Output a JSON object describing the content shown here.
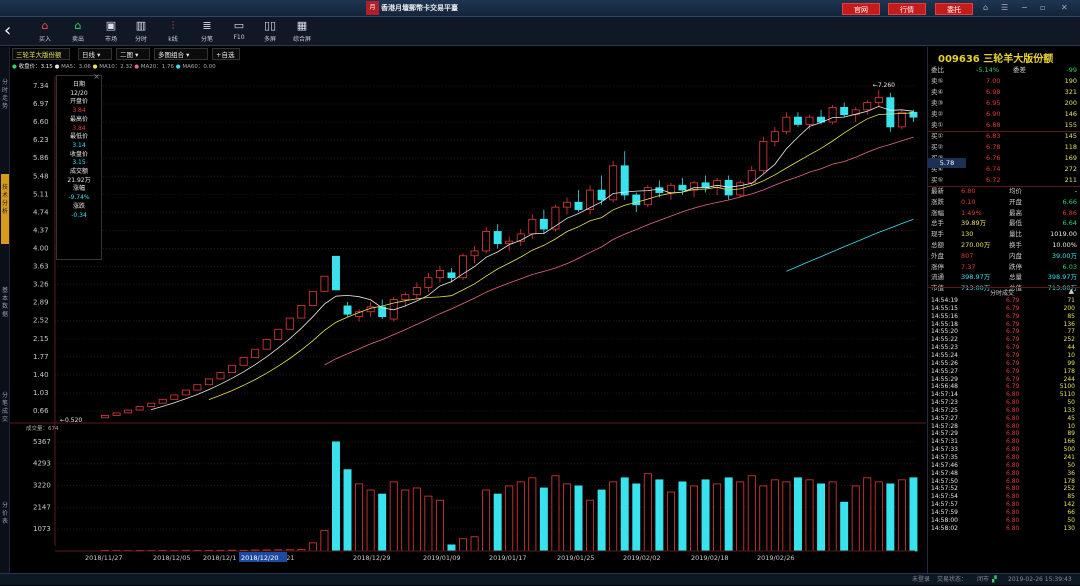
{
  "window": {
    "title": "香港月壇郵幣卡交易平臺",
    "logo": "月",
    "buttons": [
      "官网",
      "行情",
      "委托"
    ],
    "controls": [
      "⌂",
      "☰",
      "−",
      "▫",
      "✕"
    ]
  },
  "toolbar": [
    {
      "label": "买入",
      "icon": "buy-icon",
      "glyph": "⌂",
      "color": "#e84a4a"
    },
    {
      "label": "卖出",
      "icon": "sell-icon",
      "glyph": "⌂",
      "color": "#39d36b"
    },
    {
      "label": "市场",
      "icon": "market-icon",
      "glyph": "▣",
      "color": "#dde"
    },
    {
      "label": "分时",
      "icon": "timeshare-icon",
      "glyph": "▥",
      "color": "#dde"
    },
    {
      "label": "k线",
      "icon": "kline-icon",
      "glyph": "⫶",
      "color": "#e84a4a"
    },
    {
      "label": "分笔",
      "icon": "ticks-icon",
      "glyph": "≣",
      "color": "#dde"
    },
    {
      "label": "F10",
      "icon": "f10-icon",
      "glyph": "▭",
      "color": "#dde"
    },
    {
      "label": "多屏",
      "icon": "multiscreen-icon",
      "glyph": "▯▯",
      "color": "#dde"
    },
    {
      "label": "综合屏",
      "icon": "composite-icon",
      "glyph": "▦",
      "color": "#dde"
    }
  ],
  "sidebar": [
    {
      "label": "分时走势",
      "active": false
    },
    {
      "label": "技术分析",
      "active": true
    },
    {
      "label": "基本数据",
      "active": false
    },
    {
      "label": "分笔成交",
      "active": false
    },
    {
      "label": "分价表",
      "active": false
    }
  ],
  "tabs": {
    "name": "三轮羊大版份额",
    "period": "日线",
    "layout": "二图",
    "combo": "多图组合",
    "watch": "+自选"
  },
  "legend": {
    "close": "收盘价：3.15",
    "ma5": "MA5：3.06",
    "ma10": "MA10：2.32",
    "ma20": "MA20：1.76",
    "ma60": "MA60：0.00",
    "volume": "成交量：674"
  },
  "tooltip": {
    "date_label": "日期",
    "date": "12/20",
    "open_label": "开盘价",
    "open": "3.84",
    "high_label": "最高价",
    "high": "3.84",
    "low_label": "最低价",
    "low": "3.14",
    "close_label": "收盘价",
    "close": "3.15",
    "amount_label": "成交额",
    "amount": "21.92万",
    "change_pct_label": "涨幅",
    "change_pct": "-9.74%",
    "change_label": "涨跌",
    "change": "-0.34"
  },
  "chart_data": {
    "type": "candlestick",
    "y_ticks": [
      "7.34",
      "6.97",
      "6.60",
      "6.23",
      "5.86",
      "5.48",
      "5.11",
      "4.74",
      "4.37",
      "4.00",
      "3.63",
      "3.26",
      "2.89",
      "2.52",
      "2.15",
      "1.77",
      "1.40",
      "1.03",
      "0.66"
    ],
    "vol_ticks": [
      "5367",
      "4293",
      "3220",
      "2147",
      "1073"
    ],
    "x_ticks": [
      "2018/11/27",
      "2018/12/05",
      "2018/12/1",
      "2018/12/21",
      "2018/12/29",
      "2019/01/09",
      "2019/01/17",
      "2019/01/25",
      "2019/02/02",
      "2019/02/18",
      "2019/02/26"
    ],
    "cursor_date": "2018/12/20",
    "cursor_price": "5.78",
    "max_label": "←7.260",
    "min_label": "←0.520",
    "candles": [
      [
        0.52,
        0.57,
        0.52,
        0.57
      ],
      [
        0.57,
        0.62,
        0.57,
        0.62
      ],
      [
        0.62,
        0.68,
        0.62,
        0.68
      ],
      [
        0.68,
        0.75,
        0.68,
        0.75
      ],
      [
        0.75,
        0.82,
        0.75,
        0.82
      ],
      [
        0.82,
        0.9,
        0.82,
        0.9
      ],
      [
        0.9,
        0.99,
        0.9,
        0.99
      ],
      [
        0.99,
        1.09,
        0.99,
        1.09
      ],
      [
        1.09,
        1.2,
        1.09,
        1.2
      ],
      [
        1.2,
        1.32,
        1.2,
        1.32
      ],
      [
        1.32,
        1.45,
        1.32,
        1.45
      ],
      [
        1.45,
        1.6,
        1.45,
        1.6
      ],
      [
        1.6,
        1.76,
        1.6,
        1.76
      ],
      [
        1.76,
        1.93,
        1.76,
        1.93
      ],
      [
        1.93,
        2.13,
        1.93,
        2.13
      ],
      [
        2.13,
        2.34,
        2.13,
        2.34
      ],
      [
        2.34,
        2.57,
        2.34,
        2.57
      ],
      [
        2.57,
        2.83,
        2.57,
        2.83
      ],
      [
        2.83,
        3.12,
        2.83,
        3.12
      ],
      [
        3.12,
        3.43,
        3.12,
        3.43
      ],
      [
        3.84,
        3.84,
        3.14,
        3.15
      ],
      [
        2.82,
        2.9,
        2.6,
        2.65
      ],
      [
        2.6,
        2.75,
        2.5,
        2.7
      ],
      [
        2.7,
        2.9,
        2.6,
        2.8
      ],
      [
        2.8,
        2.95,
        2.55,
        2.6
      ],
      [
        2.55,
        3.0,
        2.5,
        2.95
      ],
      [
        2.95,
        3.1,
        2.8,
        3.05
      ],
      [
        3.05,
        3.3,
        2.95,
        3.2
      ],
      [
        3.2,
        3.5,
        3.1,
        3.4
      ],
      [
        3.4,
        3.65,
        3.3,
        3.55
      ],
      [
        3.5,
        3.6,
        3.3,
        3.4
      ],
      [
        3.4,
        3.9,
        3.35,
        3.85
      ],
      [
        3.85,
        4.05,
        3.7,
        3.95
      ],
      [
        3.95,
        4.45,
        3.9,
        4.35
      ],
      [
        4.35,
        4.5,
        4.0,
        4.1
      ],
      [
        4.1,
        4.25,
        3.95,
        4.15
      ],
      [
        4.15,
        4.4,
        4.05,
        4.3
      ],
      [
        4.3,
        4.7,
        4.2,
        4.6
      ],
      [
        4.6,
        4.8,
        4.3,
        4.4
      ],
      [
        4.4,
        4.9,
        4.35,
        4.85
      ],
      [
        4.85,
        5.05,
        4.7,
        4.95
      ],
      [
        4.95,
        5.2,
        4.75,
        4.8
      ],
      [
        4.8,
        5.3,
        4.7,
        5.2
      ],
      [
        5.2,
        5.5,
        4.9,
        5.0
      ],
      [
        5.0,
        5.8,
        4.95,
        5.7
      ],
      [
        5.7,
        6.0,
        5.0,
        5.1
      ],
      [
        5.1,
        5.15,
        4.75,
        4.9
      ],
      [
        4.9,
        5.3,
        4.85,
        5.25
      ],
      [
        5.25,
        5.4,
        5.05,
        5.15
      ],
      [
        5.15,
        5.35,
        5.0,
        5.3
      ],
      [
        5.3,
        5.45,
        5.1,
        5.2
      ],
      [
        5.2,
        5.4,
        5.05,
        5.35
      ],
      [
        5.35,
        5.5,
        5.15,
        5.25
      ],
      [
        5.25,
        5.45,
        5.1,
        5.4
      ],
      [
        5.4,
        5.5,
        5.0,
        5.1
      ],
      [
        5.1,
        5.4,
        5.05,
        5.35
      ],
      [
        5.35,
        5.7,
        5.3,
        5.6
      ],
      [
        5.6,
        6.3,
        5.55,
        6.2
      ],
      [
        6.2,
        6.5,
        6.1,
        6.4
      ],
      [
        6.4,
        6.8,
        6.35,
        6.7
      ],
      [
        6.7,
        6.8,
        6.5,
        6.55
      ],
      [
        6.55,
        6.75,
        6.45,
        6.7
      ],
      [
        6.7,
        6.85,
        6.55,
        6.6
      ],
      [
        6.6,
        6.95,
        6.55,
        6.9
      ],
      [
        6.9,
        7.0,
        6.7,
        6.75
      ],
      [
        6.75,
        6.9,
        6.6,
        6.85
      ],
      [
        6.85,
        7.05,
        6.75,
        7.0
      ],
      [
        7.0,
        7.26,
        6.9,
        7.1
      ],
      [
        7.1,
        7.2,
        6.4,
        6.5
      ],
      [
        6.5,
        6.85,
        6.45,
        6.8
      ],
      [
        6.8,
        6.85,
        6.6,
        6.7
      ]
    ],
    "volumes": [
      30,
      25,
      20,
      28,
      22,
      30,
      25,
      35,
      30,
      28,
      32,
      40,
      35,
      45,
      50,
      55,
      60,
      70,
      400,
      1000,
      5367,
      4000,
      3300,
      3000,
      2800,
      3400,
      3000,
      3100,
      2700,
      2500,
      300,
      600,
      700,
      3000,
      2800,
      3200,
      3400,
      3600,
      3100,
      3700,
      3300,
      3200,
      2500,
      3000,
      3400,
      3600,
      3300,
      3800,
      3500,
      2900,
      3400,
      3200,
      3500,
      3300,
      3600,
      3400,
      3700,
      3200,
      3500,
      3400,
      3600,
      3500,
      3300,
      3400,
      2400,
      3200,
      3600,
      3400,
      3300,
      3500,
      3600
    ]
  },
  "quote": {
    "code": "009636",
    "name": "三轮羊大版份额",
    "ratio": {
      "label": "委比",
      "value": "-5.14%",
      "diff_label": "委差",
      "diff": "-99"
    },
    "asks": [
      {
        "label": "卖⑤",
        "price": "7.00",
        "vol": "190"
      },
      {
        "label": "卖④",
        "price": "6.98",
        "vol": "321"
      },
      {
        "label": "卖③",
        "price": "6.95",
        "vol": "200"
      },
      {
        "label": "卖②",
        "price": "6.90",
        "vol": "146"
      },
      {
        "label": "卖①",
        "price": "6.88",
        "vol": "155"
      }
    ],
    "bids": [
      {
        "label": "买①",
        "price": "6.83",
        "vol": "145"
      },
      {
        "label": "买②",
        "price": "6.78",
        "vol": "118"
      },
      {
        "label": "买③",
        "price": "6.76",
        "vol": "169"
      },
      {
        "label": "买④",
        "price": "6.74",
        "vol": "272"
      },
      {
        "label": "买⑤",
        "price": "6.72",
        "vol": "211"
      }
    ],
    "stats": [
      [
        {
          "k": "最新",
          "v": "6.80",
          "c": "r"
        },
        {
          "k": "均价",
          "v": "-",
          "c": "w"
        }
      ],
      [
        {
          "k": "涨跌",
          "v": "0.10",
          "c": "r"
        },
        {
          "k": "开盘",
          "v": "6.66",
          "c": "g"
        }
      ],
      [
        {
          "k": "涨幅",
          "v": "1.49%",
          "c": "r"
        },
        {
          "k": "最高",
          "v": "6.86",
          "c": "r"
        }
      ],
      [
        {
          "k": "总手",
          "v": "39.89万",
          "c": "y"
        },
        {
          "k": "最低",
          "v": "6.64",
          "c": "g"
        }
      ],
      [
        {
          "k": "现手",
          "v": "130",
          "c": "y"
        },
        {
          "k": "量比",
          "v": "1019.00",
          "c": "w"
        }
      ],
      [
        {
          "k": "总额",
          "v": "270.00万",
          "c": "y"
        },
        {
          "k": "换手",
          "v": "10.00%",
          "c": "w"
        }
      ],
      [
        {
          "k": "外盘",
          "v": "807",
          "c": "r"
        },
        {
          "k": "内盘",
          "v": "39.00万",
          "c": "c"
        }
      ],
      [
        {
          "k": "涨停",
          "v": "7.37",
          "c": "r"
        },
        {
          "k": "跌停",
          "v": "6.03",
          "c": "g"
        }
      ],
      [
        {
          "k": "流通",
          "v": "398.97万",
          "c": "c"
        },
        {
          "k": "总量",
          "v": "398.97万",
          "c": "c"
        }
      ],
      [
        {
          "k": "市值",
          "v": "713.00万",
          "c": "c"
        },
        {
          "k": "总值",
          "v": "713.00万",
          "c": "c"
        }
      ]
    ],
    "ticks_header": "分时成交",
    "ticks": [
      [
        "14:54:19",
        "6.79",
        "71"
      ],
      [
        "14:55:15",
        "6.79",
        "200"
      ],
      [
        "14:55:16",
        "6.79",
        "85"
      ],
      [
        "14:55:18",
        "6.79",
        "136"
      ],
      [
        "14:55:20",
        "6.79",
        "77"
      ],
      [
        "14:55:22",
        "6.79",
        "252"
      ],
      [
        "14:55:23",
        "6.79",
        "44"
      ],
      [
        "14:55:24",
        "6.79",
        "10"
      ],
      [
        "14:55:26",
        "6.79",
        "99"
      ],
      [
        "14:55:27",
        "6.79",
        "178"
      ],
      [
        "14:55:29",
        "6.79",
        "244"
      ],
      [
        "14:56:48",
        "6.79",
        "5100"
      ],
      [
        "14:57:14",
        "6.80",
        "5110"
      ],
      [
        "14:57:23",
        "6.80",
        "50"
      ],
      [
        "14:57:25",
        "6.80",
        "133"
      ],
      [
        "14:57:27",
        "6.80",
        "45"
      ],
      [
        "14:57:28",
        "6.80",
        "10"
      ],
      [
        "14:57:29",
        "6.80",
        "89"
      ],
      [
        "14:57:31",
        "6.80",
        "166"
      ],
      [
        "14:57:33",
        "6.80",
        "500"
      ],
      [
        "14:57:35",
        "6.80",
        "241"
      ],
      [
        "14:57:46",
        "6.80",
        "50"
      ],
      [
        "14:57:48",
        "6.80",
        "36"
      ],
      [
        "14:57:50",
        "6.80",
        "178"
      ],
      [
        "14:57:52",
        "6.80",
        "252"
      ],
      [
        "14:57:54",
        "6.80",
        "85"
      ],
      [
        "14:57:57",
        "6.80",
        "142"
      ],
      [
        "14:57:59",
        "6.80",
        "66"
      ],
      [
        "14:58:00",
        "6.80",
        "50"
      ],
      [
        "14:58:02",
        "6.80",
        "130"
      ]
    ]
  },
  "status": {
    "login": "未登录",
    "trade_label": "交易状态：",
    "trade": "闭市",
    "time": "2019-02-26 15:39:43"
  }
}
